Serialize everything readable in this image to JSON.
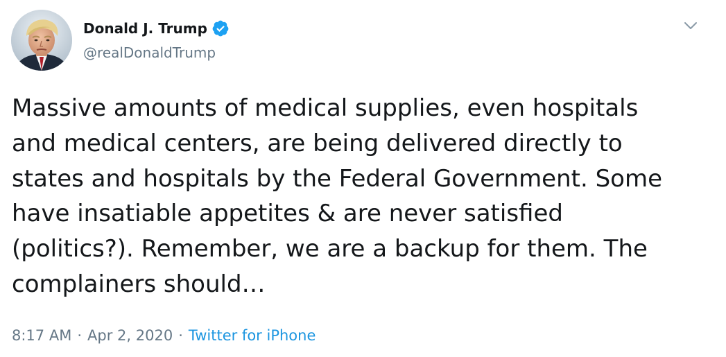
{
  "author": {
    "display_name": "Donald J. Trump",
    "handle": "@realDonaldTrump",
    "verified": true
  },
  "tweet": {
    "text": "Massive amounts of medical supplies, even hospitals\nand medical centers, are being delivered directly to\nstates and hospitals by the Federal Government. Some\nhave insatiable appetites & are never satisfied\n(politics?). Remember, we are a backup for them. The\ncomplainers should…"
  },
  "meta": {
    "time": "8:17 AM",
    "separator": "·",
    "date": "Apr 2, 2020",
    "source": "Twitter for iPhone"
  },
  "icons": {
    "verified": "verified-badge-icon",
    "menu": "chevron-down-icon"
  },
  "colors": {
    "text_primary": "#14171a",
    "text_secondary": "#657786",
    "link": "#1b95e0",
    "verified_badge": "#1da1f2",
    "caret": "#8899a6"
  }
}
